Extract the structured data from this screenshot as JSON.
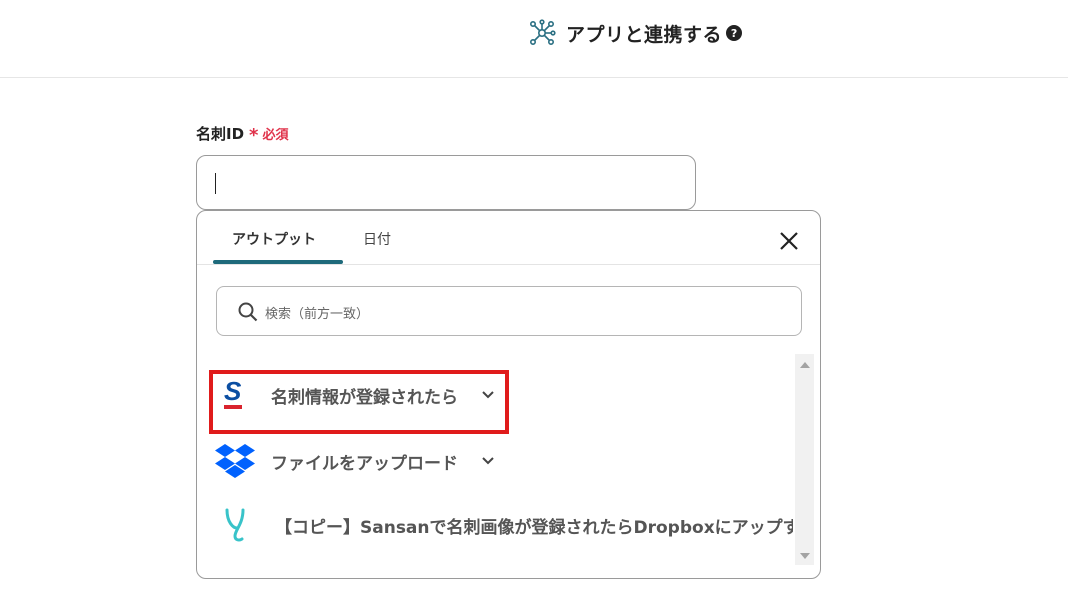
{
  "header": {
    "title": "アプリと連携する",
    "help_glyph": "?",
    "icon": "hub-network-icon"
  },
  "field": {
    "label": "名刺ID",
    "required_star": "*",
    "required_text": "必須",
    "value": ""
  },
  "popover": {
    "tabs": [
      {
        "label": "アウトプット",
        "active": true
      },
      {
        "label": "日付",
        "active": false
      }
    ],
    "close_icon": "close-icon",
    "search": {
      "placeholder": "検索（前方一致）"
    },
    "items": [
      {
        "label": "名刺情報が登録されたら",
        "icon": "sansan-logo-icon",
        "highlighted": true
      },
      {
        "label": "ファイルをアップロード",
        "icon": "dropbox-logo-icon",
        "highlighted": false
      },
      {
        "label": "【コピー】Sansanで名刺画像が登録されたらDropboxにアップする",
        "icon": "yoom-logo-icon",
        "highlighted": false
      }
    ]
  },
  "colors": {
    "accent": "#1e6a7b",
    "required": "#e0334b",
    "highlight": "#e01b1b",
    "sansan_blue": "#0b4ea2",
    "sansan_red": "#d9232e",
    "dropbox_blue": "#0061fe",
    "yoom_teal": "#38c3c9"
  }
}
